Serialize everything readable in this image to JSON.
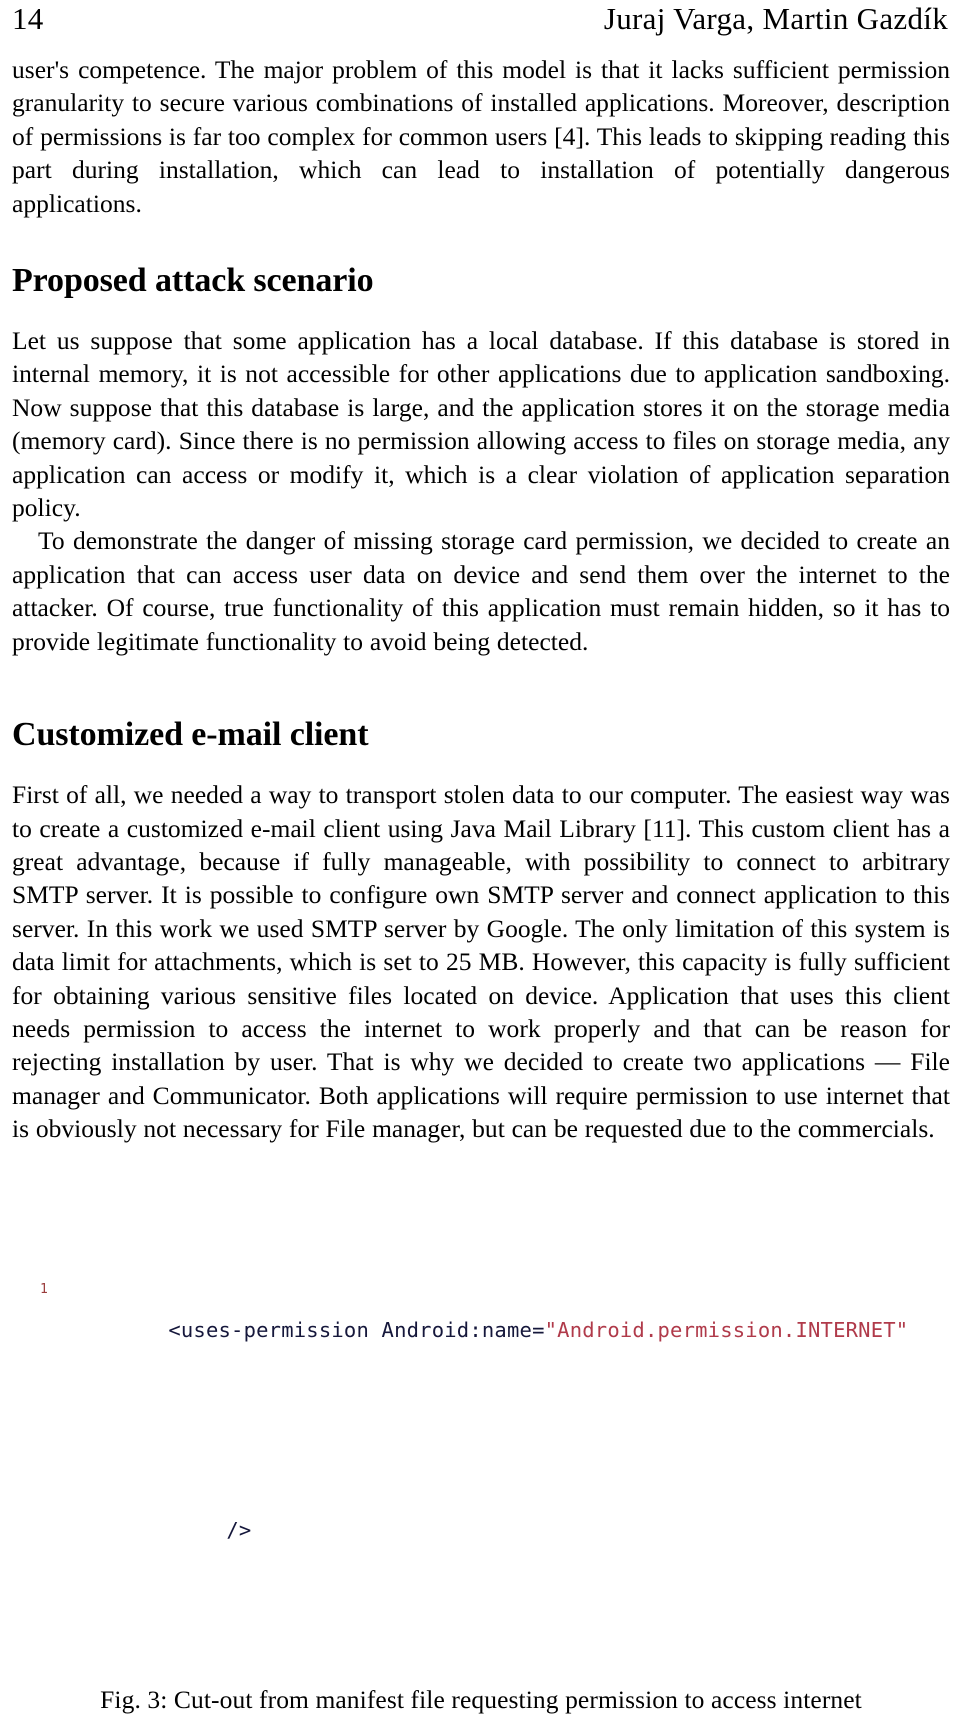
{
  "running_head": {
    "page_number": "14",
    "authors": "Juraj Varga, Martin Gazdík"
  },
  "body": {
    "paragraph_continued": "user's competence. The major problem of this model is that it lacks sufficient permission granularity to secure various combinations of installed applications. Moreover, description of permissions is far too complex for common users [4]. This leads to skipping reading this part during installation, which can lead to installation of potentially dangerous applications.",
    "section_attack_heading": "Proposed attack scenario",
    "section_attack_paragraph_1": "Let us suppose that some application has a local database. If this database is stored in internal memory, it is not accessible for other applications due to application sandboxing. Now suppose that this database is large, and the application stores it on the storage media (memory card). Since there is no permission allowing access to files on storage media, any application can access or modify it, which is a clear violation of application separation policy.",
    "section_attack_paragraph_2": "To demonstrate the danger of missing storage card permission, we decided to create an application that can access user data on device and send them over the internet to the attacker. Of course, true functionality of this application must remain hidden, so it has to provide legitimate functionality to avoid being detected.",
    "section_mail_heading": "Customized e-mail client",
    "section_mail_paragraph_1": "First of all, we needed a way to transport stolen data to our computer. The easiest way was to create a customized e-mail client using Java Mail Library [11]. This custom client has a great advantage, because if fully manageable, with possibility to connect to arbitrary SMTP server. It is possible to configure own SMTP server and connect application to this server. In this work we used SMTP server by Google. The only limitation of this system is data limit for attachments, which is set to 25 MB. However, this capacity is fully sufficient for obtaining various sensitive files located on device. Application that uses this client needs permission to access the internet to work properly and that can be reason for rejecting installation by user. That is why we decided to create two applications — File manager and Communicator. Both applications will require permission to use internet that is obviously not necessary for File manager, but can be requested due to the commercials."
  },
  "figure": {
    "line_number_1": "1",
    "code_line_1_tag": "<uses-permission Android:name=",
    "code_line_1_string": "\"Android.permission.INTERNET\"",
    "code_line_2": "/>",
    "caption": "Fig. 3: Cut-out from manifest file requesting permission to access internet"
  },
  "colors": {
    "text": "#000000",
    "code_tag": "#15173b",
    "code_string": "#b03a4a",
    "line_number": "#9a3b3b",
    "page_background": "#ffffff"
  }
}
